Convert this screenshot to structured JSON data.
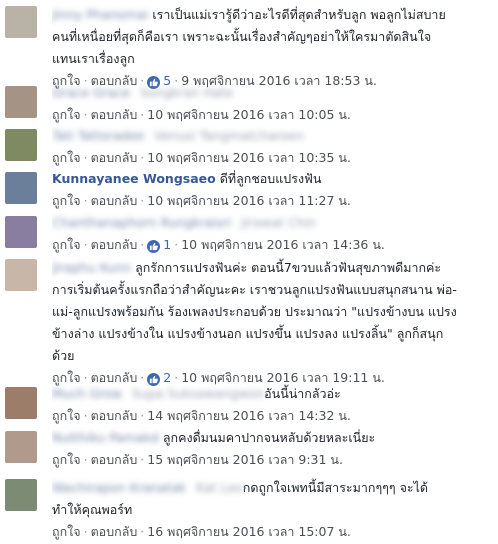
{
  "ui": {
    "like": "ถูกใจ",
    "reply": "ตอบกลับ",
    "dot": "·"
  },
  "comments": [
    {
      "name": "Jinny Phanomai",
      "text_lines": [
        "เราเป็นแม่เรารู้ดีว่าอะไรดีที่สุดสำหรับลูก พอลูกไม่สบาย",
        "คนที่เหนื่อยที่สุดก็คือเรา เพราะฉะนั้นเรื่องสำคัญๆอย่าให้ใครมาตัดสินใจ",
        "แทนเราเรื่องลูก"
      ],
      "likes": "5",
      "time": "9 พฤศจิกายน 2016 เวลา 18:53 น."
    },
    {
      "name": "Grace Grace",
      "blurred": "Songkran Hate",
      "text_lines": [],
      "likes": "",
      "time": "10 พฤศจิกายน 2016 เวลา 10:05 น."
    },
    {
      "name": "Tati Tattoradee",
      "blurred": "Venusi Tangmatcharoen",
      "text_lines": [],
      "likes": "",
      "time": "10 พฤศจิกายน 2016 เวลา 10:35 น."
    },
    {
      "name": "Kunnayanee Wongsaeo",
      "text_lines": [
        "ดีที่ลูกชอบแปรงฟัน"
      ],
      "likes": "",
      "time": "10 พฤศจิกายน 2016 เวลา 11:27 น."
    },
    {
      "name": "Chanthanaphorn Rungkraisri",
      "blurred": "Jirawat Chin",
      "text_lines": [],
      "likes": "1",
      "time": "10 พฤศจิกายน 2016 เวลา 14:36 น."
    },
    {
      "name": "Jiraphu Kunn",
      "text_lines": [
        "ลูกรักการแปรงฟันค่ะ ตอนนี้7ขวบแล้วฟันสุขภาพดีมากค่ะ",
        "การเริ่มต้นครั้งแรกถือว่าสำคัญนะคะ เราชวนลูกแปรงฟันแบบสนุกสนาน พ่อ-",
        "แม่-ลูกแปรงพร้อมกัน ร้องเพลงประกอบด้วย ประมาณว่า \"แปรงข้างบน แปรง",
        "ข้างล่าง แปรงข้างใน แปรงข้างนอก แปรงขึ้น แปรงลง แปรงลิ้น\" ลูกก็สนุก",
        "ด้วย"
      ],
      "likes": "2",
      "time": "10 พฤศจิกายน 2016 เวลา 19:11 น."
    },
    {
      "name": "Much Grow",
      "blurred": "Supa Suksawangwon",
      "text_lines": [
        "อันนี้น่ากลัวอ่ะ"
      ],
      "likes": "",
      "time": "14 พฤศจิกายน 2016 เวลา 14:32 น."
    },
    {
      "name": "Nutthiku Pamakd",
      "text_lines": [
        "ลูกคงดื่มนมคาปากจนหลับด้วยหละเนี่ยะ"
      ],
      "likes": "",
      "time": "15 พฤศจิกายน 2016 เวลา 9:31 น."
    },
    {
      "name": "Wachirapon Kranatak",
      "blurred": "Kat Leo",
      "text_lines": [
        "กดถูกใจเพทนี้มีสาระมากๆๆๆ จะได้",
        "ทำให้คุณพอร์ท"
      ],
      "likes": "",
      "time": "16 พฤศจิกายน 2016 เวลา 15:07 น."
    }
  ]
}
